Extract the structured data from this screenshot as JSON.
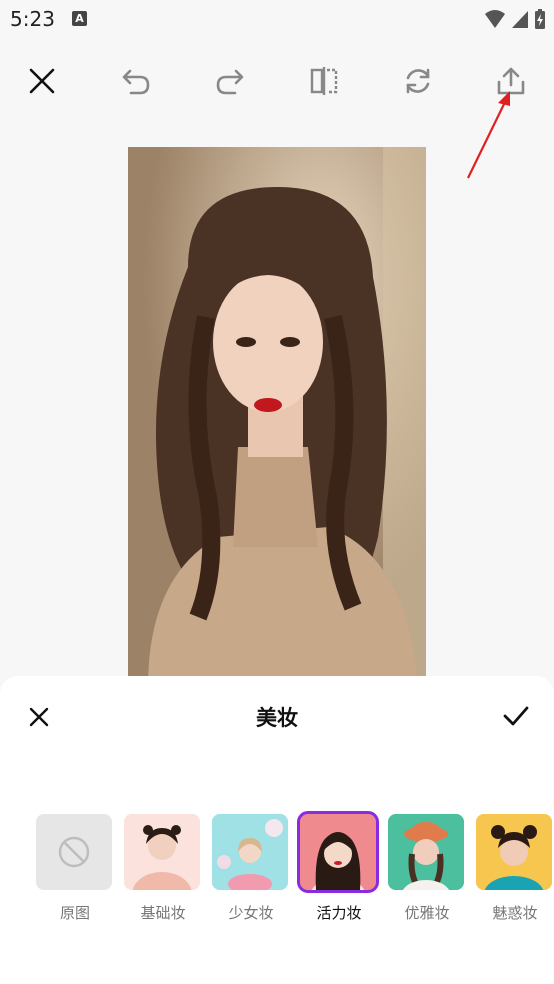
{
  "status": {
    "time": "5:23",
    "notification_letter": "A"
  },
  "toolbar": {
    "close": "close-icon",
    "undo": "undo-icon",
    "redo": "redo-icon",
    "compare": "compare-icon",
    "rotate": "rotate-icon",
    "share": "share-upload-icon"
  },
  "panel": {
    "title": "美妆",
    "styles": [
      {
        "label": "原图",
        "selected": false
      },
      {
        "label": "基础妆",
        "selected": false
      },
      {
        "label": "少女妆",
        "selected": false
      },
      {
        "label": "活力妆",
        "selected": true
      },
      {
        "label": "优雅妆",
        "selected": false
      },
      {
        "label": "魅惑妆",
        "selected": false
      }
    ]
  },
  "colors": {
    "accent": "#8a2be2",
    "annotation": "#e02020"
  }
}
